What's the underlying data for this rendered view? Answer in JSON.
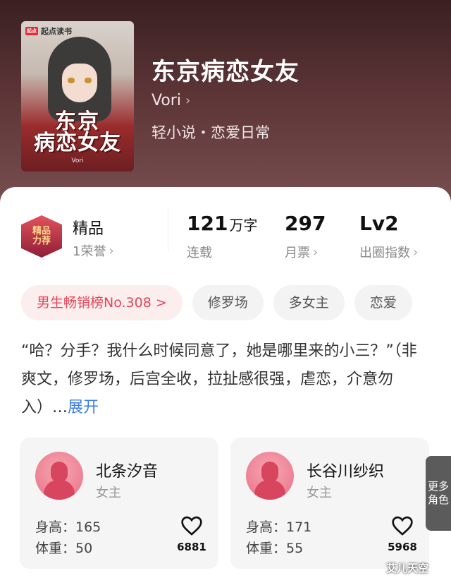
{
  "book": {
    "title": "东京病恋女友",
    "author": "Vori",
    "genre": "轻小说・恋爱日常",
    "cover": {
      "brand": "起点读书",
      "brand_badge": "起点",
      "title_art_line1": "东京",
      "title_art_line2": "病恋女友",
      "author_small": "Vori"
    }
  },
  "stats": {
    "quality": {
      "label": "精品",
      "sub": "1荣誉",
      "badge_text": "精品\n力荐"
    },
    "words": {
      "value": "121",
      "unit": "万字",
      "label": "连载"
    },
    "monthly_tickets": {
      "value": "297",
      "label": "月票"
    },
    "influence": {
      "value": "Lv2",
      "label": "出圈指数"
    }
  },
  "tags": [
    {
      "label": "男生畅销榜No.308 >"
    },
    {
      "label": "修罗场"
    },
    {
      "label": "多女主"
    },
    {
      "label": "恋爱"
    }
  ],
  "description": {
    "text": "“哈？分手？我什么时候同意了，她是哪里来的小三？”（非爽文，修罗场，后宫全收，拉扯感很强，虐恋，介意勿入）…",
    "more": "展开"
  },
  "characters": [
    {
      "name": "北条汐音",
      "role": "女主",
      "height": "身高：165",
      "weight": "体重：50",
      "likes": "6881"
    },
    {
      "name": "长谷川纱织",
      "role": "女主",
      "height": "身高：171",
      "weight": "体重：55",
      "likes": "5968"
    }
  ],
  "more_roles": "更多角色",
  "watermark": "艾儿天空",
  "colors": {
    "accent_red": "#e5465a",
    "link_blue": "#3d7fe0",
    "header_bg": "#5d3537"
  }
}
